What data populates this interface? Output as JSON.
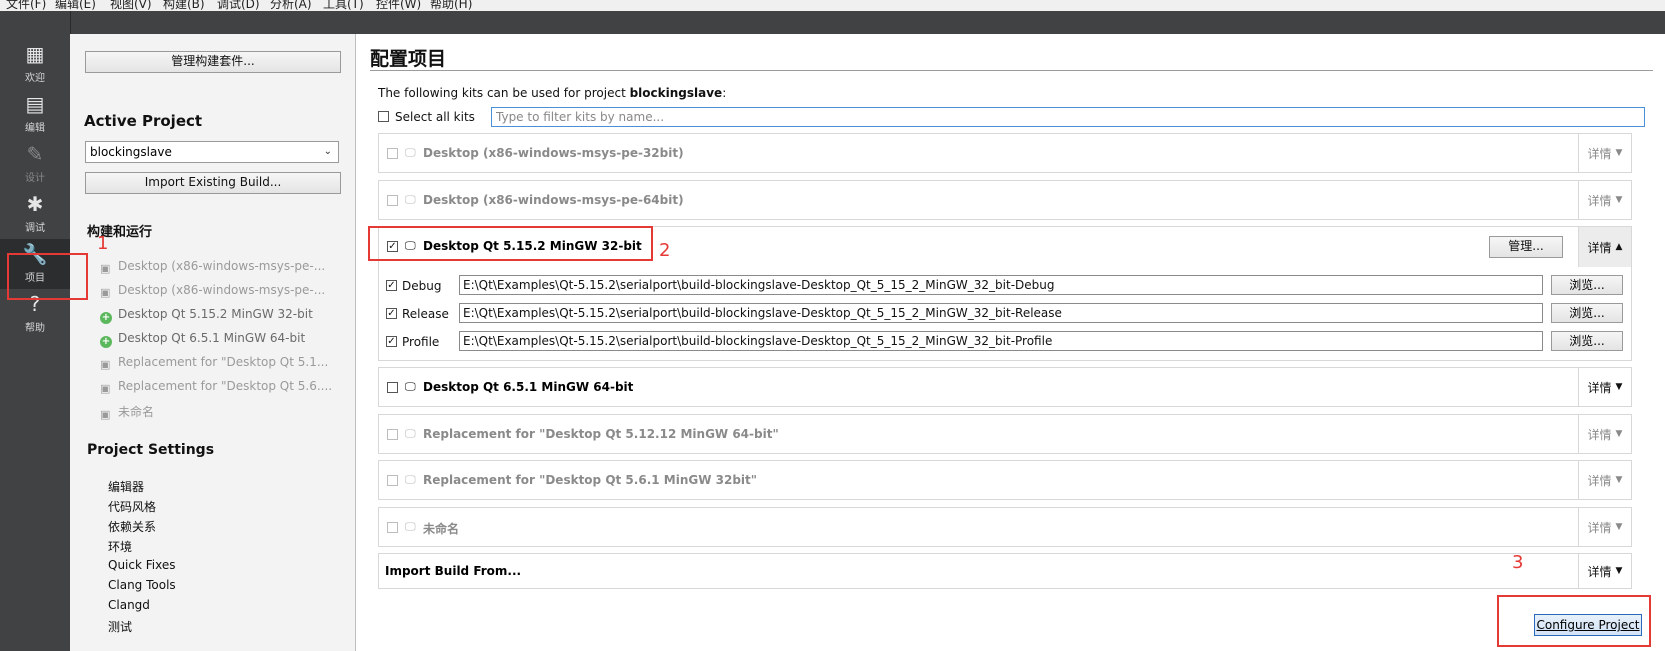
{
  "menubar": {
    "items": [
      "文件(F)",
      "编辑(E)",
      "视图(V)",
      "构建(B)",
      "调试(D)",
      "分析(A)",
      "工具(T)",
      "控件(W)",
      "帮助(H)"
    ]
  },
  "modes": [
    {
      "label": "欢迎",
      "icon": "grid-icon"
    },
    {
      "label": "编辑",
      "icon": "document-icon"
    },
    {
      "label": "设计",
      "icon": "pencil-icon"
    },
    {
      "label": "调试",
      "icon": "bug-icon"
    },
    {
      "label": "项目",
      "icon": "wrench-icon"
    },
    {
      "label": "帮助",
      "icon": "help-icon"
    }
  ],
  "left": {
    "manage_kits": "管理构建套件...",
    "active_project_header": "Active Project",
    "project_combo": "blockingslave",
    "import_existing": "Import Existing Build...",
    "build_run_header": "构建和运行",
    "kits": [
      "Desktop (x86-windows-msys-pe-...",
      "Desktop (x86-windows-msys-pe-...",
      "Desktop Qt 5.15.2 MinGW 32-bit",
      "Desktop Qt 6.5.1 MinGW 64-bit",
      "Replacement for \"Desktop Qt 5.1...",
      "Replacement for \"Desktop Qt 5.6....",
      "未命名"
    ],
    "project_settings_header": "Project Settings",
    "settings": [
      "编辑器",
      "代码风格",
      "依赖关系",
      "环境",
      "Quick Fixes",
      "Clang Tools",
      "Clangd",
      "测试"
    ]
  },
  "main": {
    "title": "配置项目",
    "intro_prefix": "The following kits can be used for project ",
    "intro_project": "blockingslave",
    "intro_suffix": ":",
    "select_all": "Select all kits",
    "filter_placeholder": "Type to filter kits by name...",
    "detail_label": "详情",
    "manage_label": "管理...",
    "browse_label": "浏览...",
    "kits": [
      "Desktop (x86-windows-msys-pe-32bit)",
      "Desktop (x86-windows-msys-pe-64bit)",
      "Desktop Qt 5.15.2 MinGW 32-bit",
      "Desktop Qt 6.5.1 MinGW 64-bit",
      "Replacement for \"Desktop Qt 5.12.12 MinGW 64-bit\"",
      "Replacement for \"Desktop Qt 5.6.1 MinGW 32bit\"",
      "未命名"
    ],
    "builds": [
      {
        "label": "Debug",
        "path": "E:\\Qt\\Examples\\Qt-5.15.2\\serialport\\build-blockingslave-Desktop_Qt_5_15_2_MinGW_32_bit-Debug"
      },
      {
        "label": "Release",
        "path": "E:\\Qt\\Examples\\Qt-5.15.2\\serialport\\build-blockingslave-Desktop_Qt_5_15_2_MinGW_32_bit-Release"
      },
      {
        "label": "Profile",
        "path": "E:\\Qt\\Examples\\Qt-5.15.2\\serialport\\build-blockingslave-Desktop_Qt_5_15_2_MinGW_32_bit-Profile"
      }
    ],
    "import_from": "Import Build From...",
    "configure_button": "Configure Project"
  },
  "annotations": [
    "1",
    "2",
    "3"
  ],
  "colors": {
    "annotation": "#e53935",
    "modebar": "#404244",
    "active_icon": "#7bc24a"
  }
}
